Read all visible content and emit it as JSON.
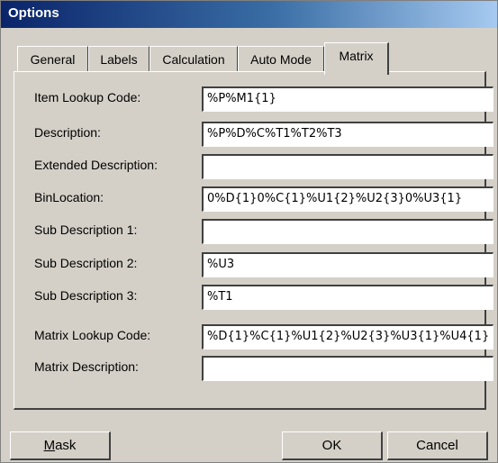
{
  "window": {
    "title": "Options"
  },
  "tabs": [
    {
      "label": "General"
    },
    {
      "label": "Labels"
    },
    {
      "label": "Calculation"
    },
    {
      "label": "Auto Mode"
    },
    {
      "label": "Matrix"
    }
  ],
  "active_tab": "Matrix",
  "fields": [
    {
      "label": "Item Lookup Code:",
      "value": "%P%M1{1}"
    },
    {
      "label": "Description:",
      "value": "%P%D%C%T1%T2%T3"
    },
    {
      "label": "Extended Description:",
      "value": ""
    },
    {
      "label": "BinLocation:",
      "value": "0%D{1}0%C{1}%U1{2}%U2{3}0%U3{1}"
    },
    {
      "label": "Sub Description 1:",
      "value": ""
    },
    {
      "label": "Sub Description 2:",
      "value": "%U3"
    },
    {
      "label": "Sub Description 3:",
      "value": "%T1"
    },
    {
      "label": "Matrix Lookup Code:",
      "value": "%D{1}%C{1}%U1{2}%U2{3}%U3{1}%U4{1}"
    },
    {
      "label": "Matrix Description:",
      "value": ""
    }
  ],
  "buttons": {
    "mask_underlined": "M",
    "mask_rest": "ask",
    "ok": "OK",
    "cancel": "Cancel"
  },
  "colors": {
    "face": "#d4d0c8",
    "title_start": "#0a246a",
    "title_end": "#a6caf0"
  }
}
